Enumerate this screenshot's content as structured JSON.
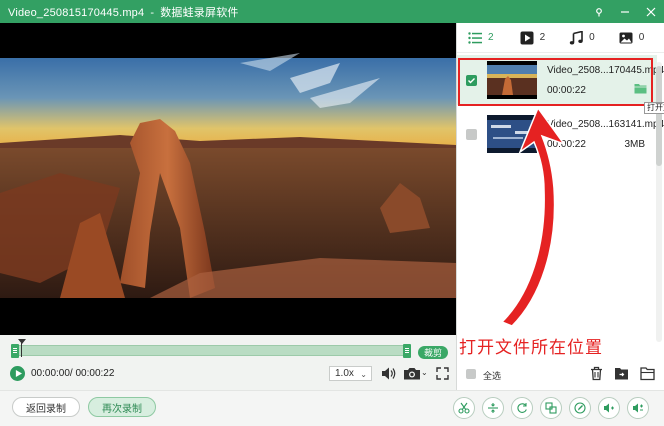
{
  "window": {
    "title": "Video_250815170445.mp4",
    "separator": "-",
    "app_name": "数据蛙录屏软件",
    "buttons": [
      "pin-icon",
      "minimize-icon",
      "close-icon"
    ]
  },
  "player": {
    "controls": {
      "cut_label": "裁剪",
      "time": "00:00:00/ 00:00:22",
      "speed": "1.0x"
    }
  },
  "panel": {
    "tabs": [
      {
        "icon": "list-icon",
        "count": "2"
      },
      {
        "icon": "video-icon",
        "count": "2"
      },
      {
        "icon": "music-icon",
        "count": "0"
      },
      {
        "icon": "image-icon",
        "count": "0"
      }
    ],
    "items": [
      {
        "name": "Video_2508...170445.mp4",
        "duration": "00:00:22",
        "selected": true
      },
      {
        "name": "Video_2508...163141.mp4",
        "duration": "00:00:22",
        "size": "3MB",
        "selected": false
      }
    ],
    "tooltip": "打开文件所在位置",
    "annotation": "打开文件所在位置",
    "select_all": "全选"
  },
  "footer": {
    "back_label": "返回录制",
    "again_label": "再次录制",
    "tools": [
      "scissors-icon",
      "split-icon",
      "rotate-icon",
      "merge-icon",
      "edit-icon",
      "volume-up-icon",
      "volume-adjust-icon"
    ]
  },
  "colors": {
    "brand": "#33a063",
    "highlight": "#e52222"
  }
}
